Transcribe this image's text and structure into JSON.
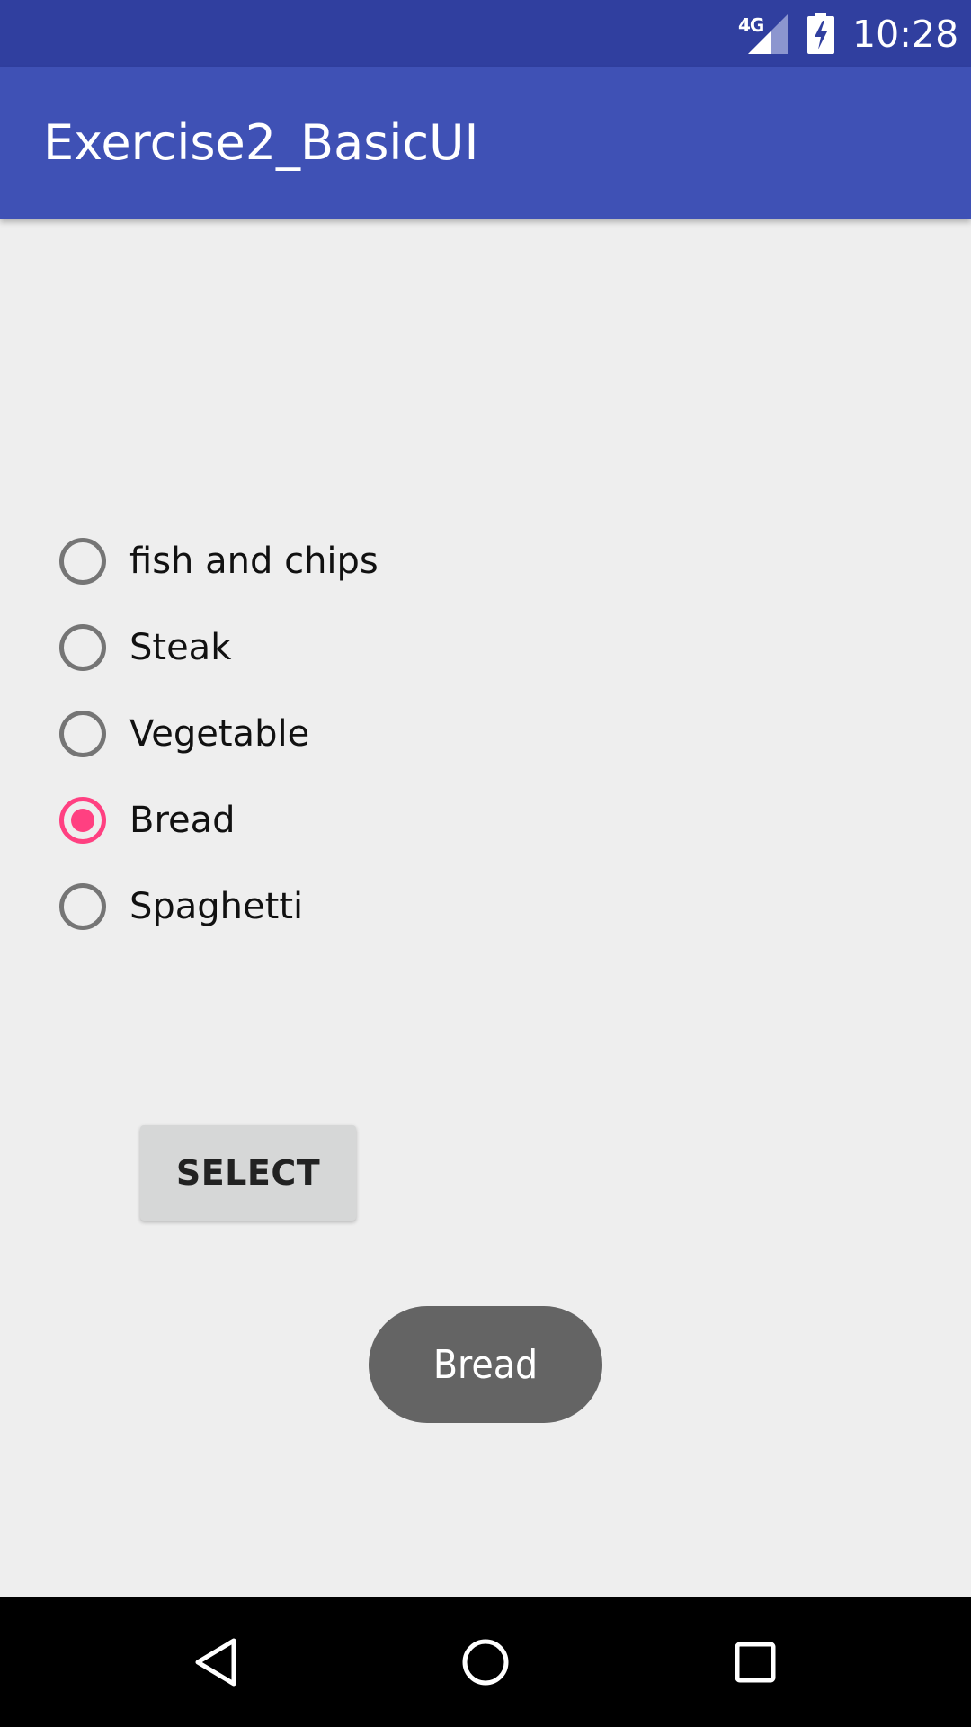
{
  "status_bar": {
    "network": "4G",
    "time": "10:28",
    "signal_icon": "cell-signal-icon",
    "battery_icon": "battery-charging-icon"
  },
  "app_bar": {
    "title": "Exercise2_BasicUI",
    "color": "#3f51b5",
    "status_color": "#303f9f"
  },
  "radio_group": {
    "options": [
      {
        "label": "fish and chips",
        "checked": false
      },
      {
        "label": "Steak",
        "checked": false
      },
      {
        "label": "Vegetable",
        "checked": false
      },
      {
        "label": "Bread",
        "checked": true
      },
      {
        "label": "Spaghetti",
        "checked": false
      }
    ],
    "accent_color": "#ff4081"
  },
  "select_button": {
    "label": "SELECT"
  },
  "toast": {
    "text": "Bread"
  },
  "nav_bar": {
    "back_icon": "back-triangle-icon",
    "home_icon": "home-circle-icon",
    "recents_icon": "recents-square-icon"
  }
}
